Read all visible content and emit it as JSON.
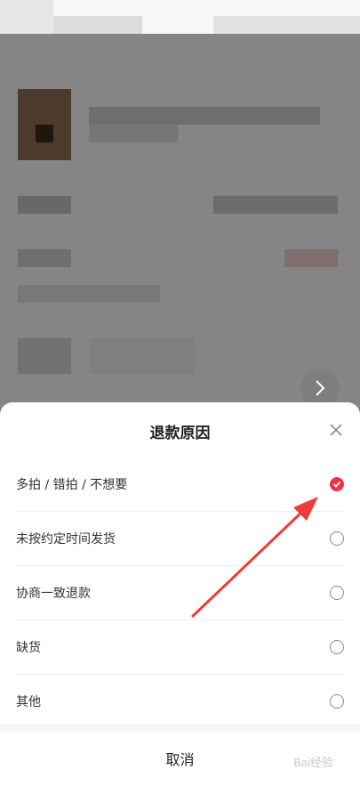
{
  "sheet": {
    "title": "退款原因",
    "options": [
      {
        "label": "多拍 / 错拍 / 不想要",
        "selected": true
      },
      {
        "label": "未按约定时间发货",
        "selected": false
      },
      {
        "label": "协商一致退款",
        "selected": false
      },
      {
        "label": "缺货",
        "selected": false
      },
      {
        "label": "其他",
        "selected": false
      }
    ],
    "cancel_label": "取消"
  },
  "colors": {
    "accent": "#f0324c",
    "overlay": "rgba(0,0,0,0.45)"
  },
  "watermark": "Bai经验"
}
